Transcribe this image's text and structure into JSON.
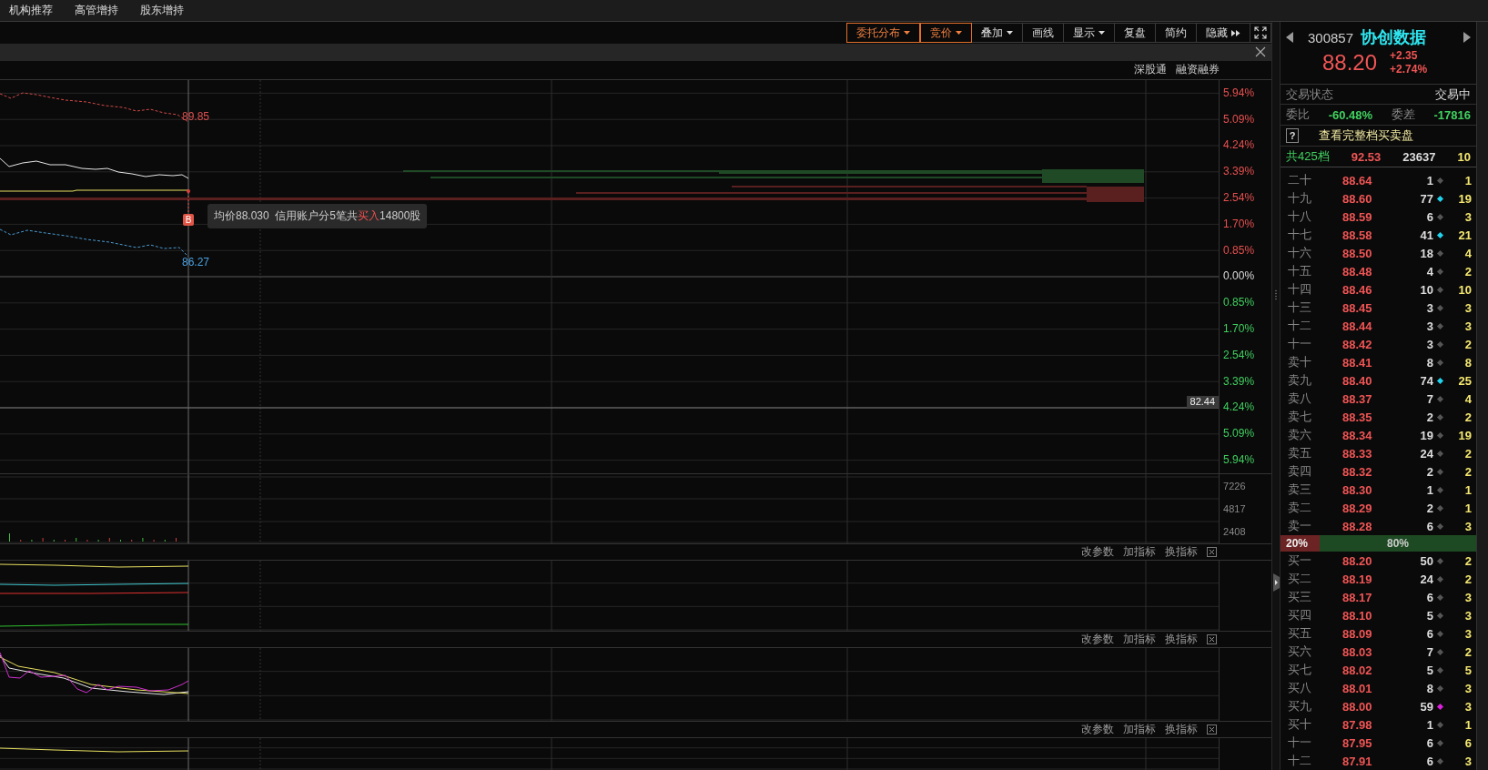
{
  "menu": [
    "机构推荐",
    "高管增持",
    "股东增持"
  ],
  "toolbar": [
    {
      "kind": "menu",
      "label": "委托分布",
      "selected": true
    },
    {
      "kind": "menu",
      "label": "竞价",
      "selected": true
    },
    {
      "kind": "menu",
      "label": "叠加",
      "selected": false
    },
    {
      "kind": "text",
      "label": "画线",
      "selected": false
    },
    {
      "kind": "menu",
      "label": "显示",
      "selected": false
    },
    {
      "kind": "text",
      "label": "复盘",
      "selected": false
    },
    {
      "kind": "text",
      "label": "简约",
      "selected": false
    },
    {
      "kind": "collapse",
      "label": "隐藏",
      "selected": false
    },
    {
      "kind": "fullscreen",
      "selected": false
    }
  ],
  "market_tags": [
    "深股通",
    "融资融券"
  ],
  "price_chart": {
    "axis_labels": [
      {
        "text": "5.94%",
        "color": "#e85050"
      },
      {
        "text": "5.09%",
        "color": "#e85050"
      },
      {
        "text": "4.24%",
        "color": "#e85050"
      },
      {
        "text": "3.39%",
        "color": "#e85050"
      },
      {
        "text": "2.54%",
        "color": "#e85050"
      },
      {
        "text": "1.70%",
        "color": "#e85050"
      },
      {
        "text": "0.85%",
        "color": "#e85050"
      },
      {
        "text": "0.00%",
        "color": "#dddddd"
      },
      {
        "text": "0.85%",
        "color": "#40d060"
      },
      {
        "text": "1.70%",
        "color": "#40d060"
      },
      {
        "text": "2.54%",
        "color": "#40d060"
      },
      {
        "text": "3.39%",
        "color": "#40d060"
      },
      {
        "text": "4.24%",
        "color": "#40d060"
      },
      {
        "text": "5.09%",
        "color": "#40d060"
      },
      {
        "text": "5.94%",
        "color": "#40d060"
      }
    ],
    "upper_label": "89.85",
    "lower_label": "86.27",
    "marker": "B",
    "cursor_price": "82.44",
    "tooltip": [
      {
        "text": "均价88.030  信用账户分5笔共",
        "highlight": false
      },
      {
        "text": "买入",
        "highlight": true
      },
      {
        "text": "14800股",
        "highlight": false
      }
    ]
  },
  "volume_chart": {
    "axis_labels": [
      "7226",
      "4817",
      "2408"
    ]
  },
  "indicator_panels": [
    {
      "actions": [
        "改参数",
        "加指标",
        "换指标"
      ]
    },
    {
      "actions": [
        "改参数",
        "加指标",
        "换指标"
      ]
    },
    {
      "actions": [
        "改参数",
        "加指标",
        "换指标"
      ]
    }
  ],
  "quote": {
    "code": "300857",
    "name": "协创数据",
    "price": "88.20",
    "change": "+2.35",
    "change_pct": "+2.74%"
  },
  "status": {
    "label": "交易状态",
    "value": "交易中"
  },
  "ratio": {
    "label": "委比",
    "value": "-60.48%",
    "diff_label": "委差",
    "diff_value": "-17816"
  },
  "full_book_button": {
    "icon": "?",
    "label": "查看完整档买卖盘"
  },
  "summary": {
    "label": "共425档",
    "price": "92.53",
    "volume": "23637",
    "count": "10"
  },
  "asks": [
    {
      "label": "二十",
      "price": "88.64",
      "volume": "1",
      "color": "#555555",
      "count": "1"
    },
    {
      "label": "十九",
      "price": "88.60",
      "volume": "77",
      "color": "#22d3ee",
      "count": "19"
    },
    {
      "label": "十八",
      "price": "88.59",
      "volume": "6",
      "color": "#555555",
      "count": "3"
    },
    {
      "label": "十七",
      "price": "88.58",
      "volume": "41",
      "color": "#22d3ee",
      "count": "21"
    },
    {
      "label": "十六",
      "price": "88.50",
      "volume": "18",
      "color": "#555555",
      "count": "4"
    },
    {
      "label": "十五",
      "price": "88.48",
      "volume": "4",
      "color": "#555555",
      "count": "2"
    },
    {
      "label": "十四",
      "price": "88.46",
      "volume": "10",
      "color": "#555555",
      "count": "10"
    },
    {
      "label": "十三",
      "price": "88.45",
      "volume": "3",
      "color": "#555555",
      "count": "3"
    },
    {
      "label": "十二",
      "price": "88.44",
      "volume": "3",
      "color": "#555555",
      "count": "3"
    },
    {
      "label": "十一",
      "price": "88.42",
      "volume": "3",
      "color": "#555555",
      "count": "2"
    },
    {
      "label": "卖十",
      "price": "88.41",
      "volume": "8",
      "color": "#555555",
      "count": "8"
    },
    {
      "label": "卖九",
      "price": "88.40",
      "volume": "74",
      "color": "#22d3ee",
      "count": "25"
    },
    {
      "label": "卖八",
      "price": "88.37",
      "volume": "7",
      "color": "#555555",
      "count": "4"
    },
    {
      "label": "卖七",
      "price": "88.35",
      "volume": "2",
      "color": "#555555",
      "count": "2"
    },
    {
      "label": "卖六",
      "price": "88.34",
      "volume": "19",
      "color": "#555555",
      "count": "19"
    },
    {
      "label": "卖五",
      "price": "88.33",
      "volume": "24",
      "color": "#555555",
      "count": "2"
    },
    {
      "label": "卖四",
      "price": "88.32",
      "volume": "2",
      "color": "#555555",
      "count": "2"
    },
    {
      "label": "卖三",
      "price": "88.30",
      "volume": "1",
      "color": "#555555",
      "count": "1"
    },
    {
      "label": "卖二",
      "price": "88.29",
      "volume": "2",
      "color": "#555555",
      "count": "1"
    },
    {
      "label": "卖一",
      "price": "88.28",
      "volume": "6",
      "color": "#555555",
      "count": "3"
    }
  ],
  "pressure": {
    "level": 0.2,
    "sell": "20%",
    "buy": "80%"
  },
  "bids": [
    {
      "label": "买一",
      "price": "88.20",
      "volume": "50",
      "color": "#555555",
      "count": "2"
    },
    {
      "label": "买二",
      "price": "88.19",
      "volume": "24",
      "color": "#555555",
      "count": "2"
    },
    {
      "label": "买三",
      "price": "88.17",
      "volume": "6",
      "color": "#555555",
      "count": "3"
    },
    {
      "label": "买四",
      "price": "88.10",
      "volume": "5",
      "color": "#555555",
      "count": "3"
    },
    {
      "label": "买五",
      "price": "88.09",
      "volume": "6",
      "color": "#555555",
      "count": "3"
    },
    {
      "label": "买六",
      "price": "88.03",
      "volume": "7",
      "color": "#555555",
      "count": "2"
    },
    {
      "label": "买七",
      "price": "88.02",
      "volume": "5",
      "color": "#555555",
      "count": "5"
    },
    {
      "label": "买八",
      "price": "88.01",
      "volume": "8",
      "color": "#555555",
      "count": "3"
    },
    {
      "label": "买九",
      "price": "88.00",
      "volume": "59",
      "color": "#e020e0",
      "count": "3"
    },
    {
      "label": "买十",
      "price": "87.98",
      "volume": "1",
      "color": "#555555",
      "count": "1"
    },
    {
      "label": "十一",
      "price": "87.95",
      "volume": "6",
      "color": "#555555",
      "count": "6"
    },
    {
      "label": "十二",
      "price": "87.91",
      "volume": "6",
      "color": "#555555",
      "count": "3"
    }
  ]
}
